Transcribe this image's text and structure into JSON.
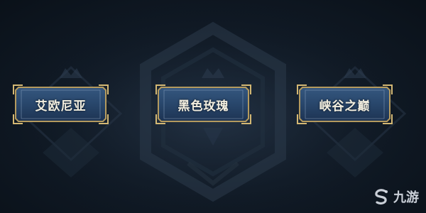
{
  "server_select": {
    "options": [
      {
        "label": "艾欧尼亚"
      },
      {
        "label": "黑色玫瑰"
      },
      {
        "label": "峡谷之巅"
      }
    ]
  },
  "watermark": {
    "text": "九游",
    "icon": "s-swirl-logo-icon"
  },
  "colors": {
    "background": "#111b27",
    "button_fill": "#2a4a73",
    "button_border": "#b49a5e",
    "label_text": "#f2eedf"
  }
}
